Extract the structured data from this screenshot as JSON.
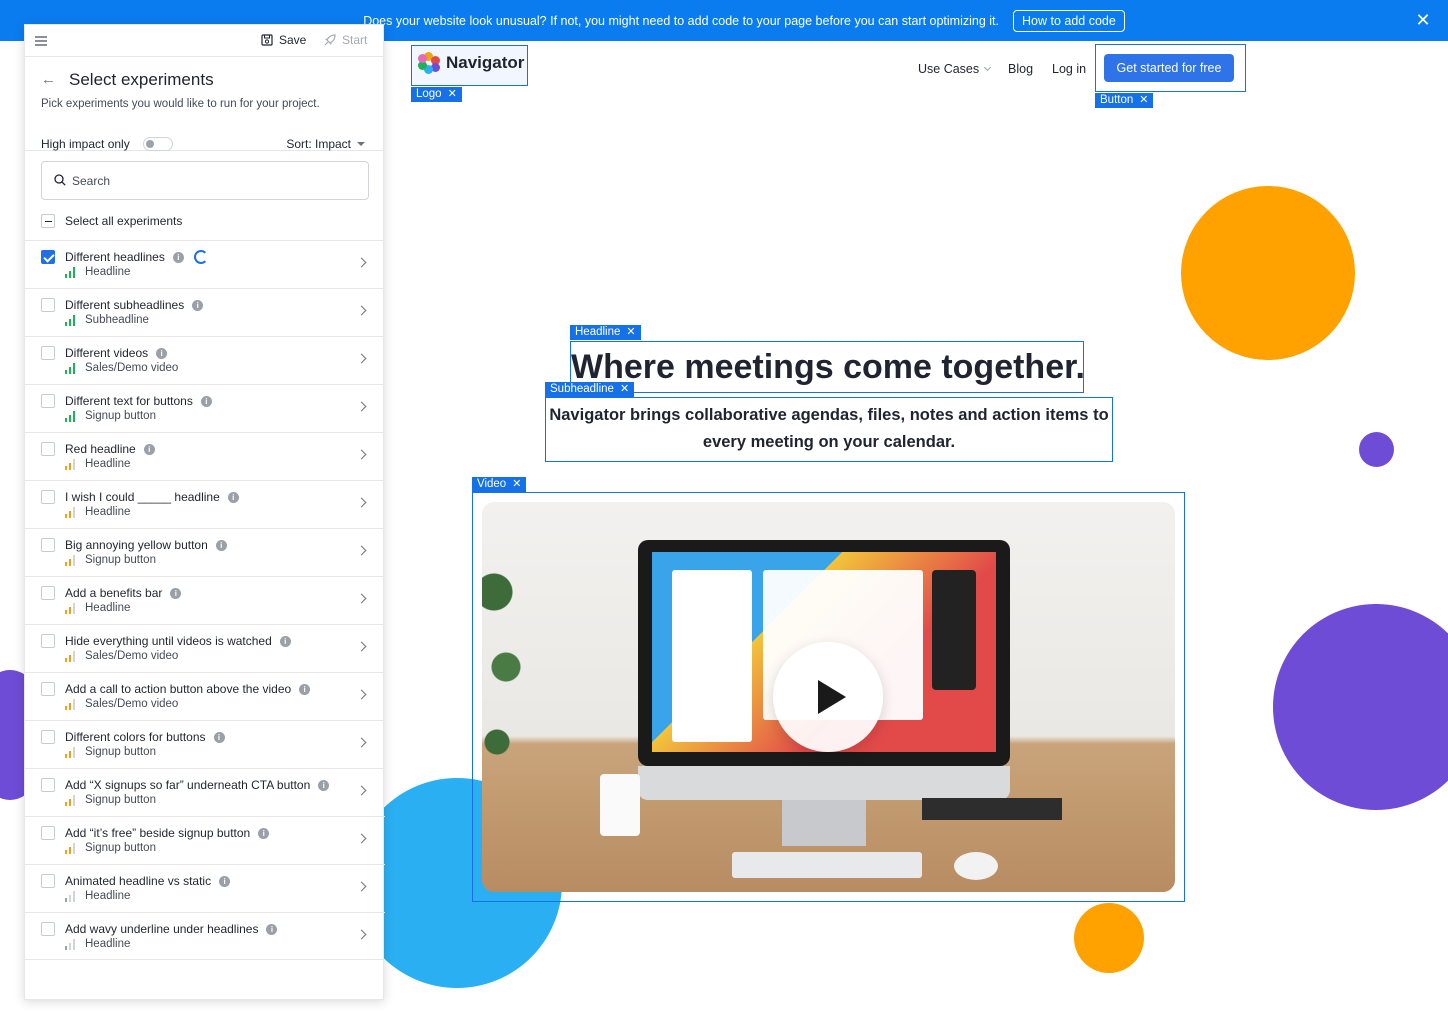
{
  "banner": {
    "message": "Does your website look unusual? If not, you might need to add code to your page before you can start optimizing it.",
    "button_label": "How to add code",
    "close_glyph": "✕"
  },
  "site": {
    "logo_text": "Navigator",
    "nav": {
      "use_cases": "Use Cases",
      "blog": "Blog",
      "login": "Log in"
    },
    "cta_label": "Get started for free",
    "headline": "Where meetings come together.",
    "subheadline": "Navigator brings collaborative agendas, files, notes and action items to every meeting on your calendar."
  },
  "annotations": {
    "logo": "Logo",
    "button": "Button",
    "headline": "Headline",
    "subheadline": "Subheadline",
    "video": "Video",
    "remove_glyph": "✕"
  },
  "sidebar": {
    "save_label": "Save",
    "start_label": "Start",
    "title": "Select experiments",
    "subtitle": "Pick experiments you would like to run for your project.",
    "high_impact_label": "High impact only",
    "sort_label": "Sort: Impact",
    "search_placeholder": "Search",
    "select_all_label": "Select all experiments",
    "experiments": [
      {
        "title": "Different headlines",
        "element": "Headline",
        "impact": "high",
        "checked": true,
        "loading": true
      },
      {
        "title": "Different subheadlines",
        "element": "Subheadline",
        "impact": "high",
        "checked": false
      },
      {
        "title": "Different videos",
        "element": "Sales/Demo video",
        "impact": "high",
        "checked": false
      },
      {
        "title": "Different text for buttons",
        "element": "Signup button",
        "impact": "high",
        "checked": false
      },
      {
        "title": "Red headline",
        "element": "Headline",
        "impact": "medium",
        "checked": false
      },
      {
        "title": "I wish I could _____ headline",
        "element": "Headline",
        "impact": "medium",
        "checked": false
      },
      {
        "title": "Big annoying yellow button",
        "element": "Signup button",
        "impact": "medium",
        "checked": false
      },
      {
        "title": "Add a benefits bar",
        "element": "Headline",
        "impact": "medium",
        "checked": false
      },
      {
        "title": "Hide everything until videos is watched",
        "element": "Sales/Demo video",
        "impact": "medium",
        "checked": false
      },
      {
        "title": "Add a call to action button above the video",
        "element": "Sales/Demo video",
        "impact": "medium",
        "checked": false
      },
      {
        "title": "Different colors for buttons",
        "element": "Signup button",
        "impact": "medium",
        "checked": false
      },
      {
        "title": "Add “X signups so far” underneath CTA button",
        "element": "Signup button",
        "impact": "medium",
        "checked": false
      },
      {
        "title": "Add “it’s free” beside signup button",
        "element": "Signup button",
        "impact": "medium",
        "checked": false
      },
      {
        "title": "Animated headline vs static",
        "element": "Headline",
        "impact": "low",
        "checked": false
      },
      {
        "title": "Add wavy underline under headlines",
        "element": "Headline",
        "impact": "low",
        "checked": false
      }
    ]
  },
  "colors": {
    "banner_blue": "#0a7cf0",
    "accent_blue": "#2e74e8",
    "annotation_blue": "#1670e8",
    "impact_high": "#1eb35b",
    "impact_medium": "#f2a20c",
    "impact_low": "#9aa0a8",
    "circle_orange": "#ffa200",
    "circle_purple": "#6e4cd6",
    "circle_sky": "#2ab0f2"
  },
  "icons": [
    "hamburger-icon",
    "save-icon",
    "rocket-icon",
    "back-arrow-icon",
    "search-icon",
    "info-icon",
    "impact-bars-icon",
    "chevron-right-icon",
    "close-icon",
    "play-icon",
    "chevron-down-icon"
  ]
}
